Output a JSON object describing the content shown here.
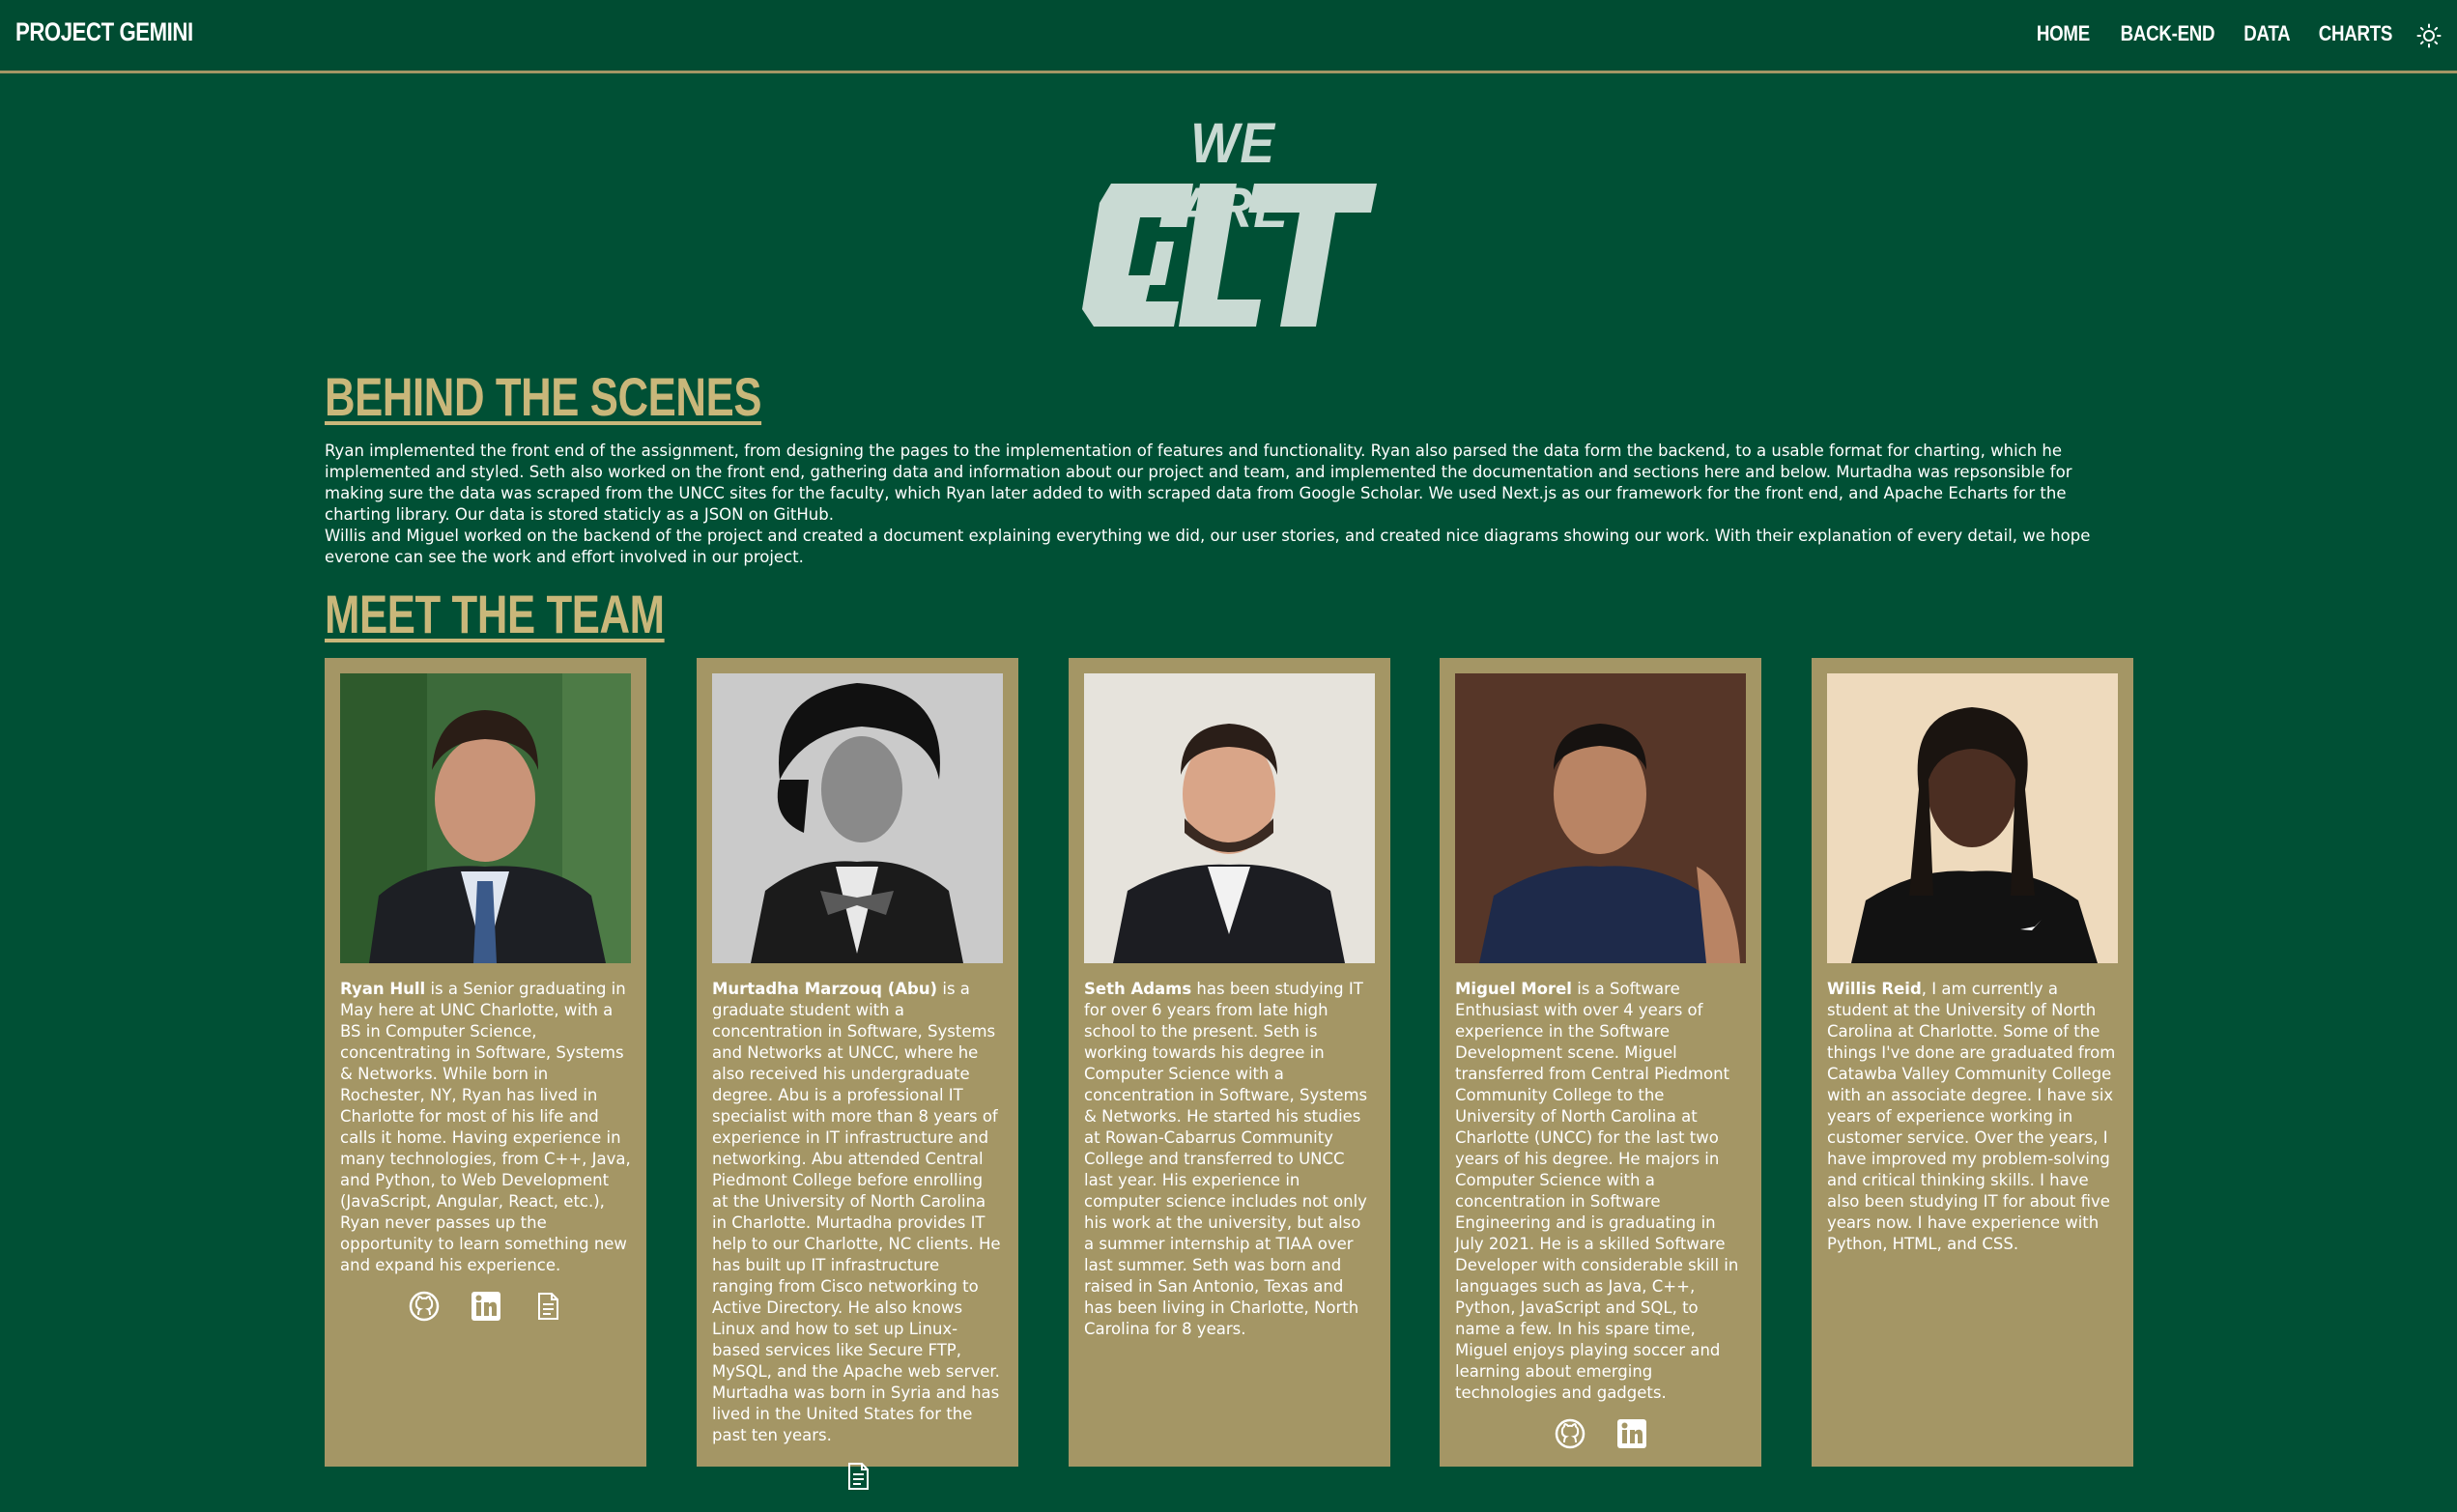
{
  "navbar": {
    "brand": "PROJECT GEMINI",
    "links": [
      "HOME",
      "BACK-END",
      "DATA",
      "CHARTS"
    ],
    "theme_icon": "sun-icon"
  },
  "hero": {
    "line1": "WE ARE",
    "line2": "CLT"
  },
  "behind": {
    "title": "BEHIND THE SCENES",
    "p1": "Ryan implemented the front end of the assignment, from designing the pages to the implementation of features and functionality. Ryan also parsed the data form the backend, to a usable format for charting, which he implemented and styled. Seth also worked on the front end, gathering data and information about our project and team, and implemented the documentation and sections here and below. Murtadha was repsonsible for making sure the data was scraped from the UNCC sites for the faculty, which Ryan later added to with scraped data from Google Scholar. We used Next.js as our framework for the front end, and Apache Echarts for the charting library. Our data is stored staticly as a JSON on GitHub.",
    "p2": "Willis and Miguel worked on the backend of the project and created a document explaining everything we did, our user stories, and created nice diagrams showing our work. With their explanation of every detail, we hope everone can see the work and effort involved in our project."
  },
  "team": {
    "title": "MEET THE TEAM",
    "members": [
      {
        "name": "Ryan Hull",
        "bio": " is a Senior graduating in May here at UNC Charlotte, with a BS in Computer Science, concentrating in Software, Systems & Networks. While born in Rochester, NY, Ryan has lived in Charlotte for most of his life and calls it home. Having experience in many technologies, from C++, Java, and Python, to Web Development (JavaScript, Angular, React, etc.), Ryan never passes up the opportunity to learn something new and expand his experience.",
        "icons": [
          "github-icon",
          "linkedin-icon",
          "document-icon"
        ]
      },
      {
        "name": "Murtadha Marzouq (Abu)",
        "bio": " is a graduate student with a concentration in Software, Systems and Networks at UNCC, where he also received his undergraduate degree. Abu is a professional IT specialist with more than 8 years of experience in IT infrastructure and networking. Abu attended Central Piedmont College before enrolling at the University of North Carolina in Charlotte. Murtadha provides IT help to our Charlotte, NC clients. He has built up IT infrastructure ranging from Cisco networking to Active Directory. He also knows Linux and how to set up Linux-based services like Secure FTP, MySQL, and the Apache web server. Murtadha was born in Syria and has lived in the United States for the past ten years.",
        "icons": [
          "document-icon"
        ]
      },
      {
        "name": "Seth Adams",
        "bio": " has been studying IT for over 6 years from late high school to the present. Seth is working towards his degree in Computer Science with a concentration in Software, Systems & Networks. He started his studies at Rowan-Cabarrus Community College and transferred to UNCC last year. His experience in computer science includes not only his work at the university, but also a summer internship at TIAA over last summer. Seth was born and raised in San Antonio, Texas and has been living in Charlotte, North Carolina for 8 years.",
        "icons": []
      },
      {
        "name": "Miguel Morel",
        "bio": " is a Software Enthusiast with over 4 years of experience in the Software Development scene. Miguel transferred from Central Piedmont Community College to the University of North Carolina at Charlotte (UNCC) for the last two years of his degree. He majors in Computer Science with a concentration in Software Engineering and is graduating in July 2021. He is a skilled Software Developer with considerable skill in languages such as Java, C++, Python, JavaScript and SQL, to name a few. In his spare time, Miguel enjoys playing soccer and learning about emerging technologies and gadgets.",
        "icons": [
          "github-icon",
          "linkedin-icon"
        ]
      },
      {
        "name": "Willis Reid",
        "bio": ", I am currently a student at the University of North Carolina at Charlotte. Some of the things I've done are graduated from Catawba Valley Community College with an associate degree. I have six years of experience working in customer service. Over the years, I have improved my problem-solving and critical thinking skills. I have also been studying IT for about five years now. I have experience with Python, HTML, and CSS.",
        "icons": []
      }
    ]
  },
  "colors": {
    "background": "#005035",
    "gold": "#a49665",
    "title_gold": "#c9b77a",
    "hero_light": "#c9dad3"
  }
}
